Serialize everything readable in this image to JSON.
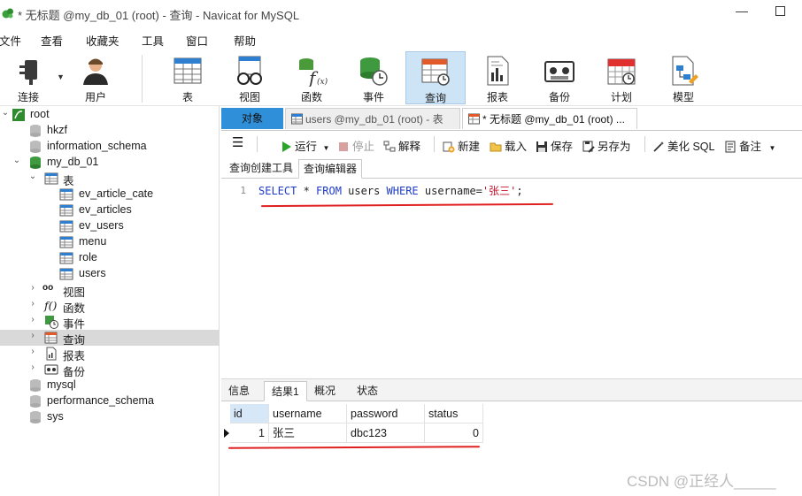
{
  "window": {
    "title": "* 无标题 @my_db_01 (root) - 查询 - Navicat for MySQL",
    "minimize_glyph": "—"
  },
  "menu": [
    "文件",
    "查看",
    "收藏夹",
    "工具",
    "窗口",
    "帮助"
  ],
  "toolbar": {
    "connect": "连接",
    "user": "用户",
    "table": "表",
    "view": "视图",
    "function": "函数",
    "event": "事件",
    "query": "查询",
    "report": "报表",
    "backup": "备份",
    "schedule": "计划",
    "model": "模型"
  },
  "tree": {
    "root": "root",
    "hkzf": "hkzf",
    "information_schema": "information_schema",
    "my_db_01": "my_db_01",
    "tables_group": "表",
    "tables": [
      "ev_article_cate",
      "ev_articles",
      "ev_users",
      "menu",
      "role",
      "users"
    ],
    "views_group": "视图",
    "functions_group": "函数",
    "events_group": "事件",
    "queries_group": "查询",
    "reports_group": "报表",
    "backups_group": "备份",
    "mysql": "mysql",
    "performance_schema": "performance_schema",
    "sys": "sys"
  },
  "tabs": {
    "objects": "对象",
    "users_tab": "users @my_db_01 (root) - 表",
    "query_tab": "* 无标题 @my_db_01 (root) ..."
  },
  "query_toolbar": {
    "run": "运行",
    "stop": "停止",
    "explain": "解释",
    "new": "新建",
    "load": "载入",
    "save": "保存",
    "save_as": "另存为",
    "beautify": "美化 SQL",
    "notes": "备注"
  },
  "editor_tabs": {
    "builder": "查询创建工具",
    "editor": "查询编辑器"
  },
  "sql": {
    "line_number": "1",
    "select": "SELECT",
    "star": " * ",
    "from": "FROM",
    "table": " users ",
    "where": "WHERE",
    "condition": " username=",
    "value": "'张三'",
    "end": ";"
  },
  "result_tabs": [
    "信息",
    "结果1",
    "概况",
    "状态"
  ],
  "result": {
    "columns": [
      "id",
      "username",
      "password",
      "status"
    ],
    "rows": [
      [
        "1",
        "张三",
        "dbc123",
        "0"
      ]
    ]
  },
  "watermark": "CSDN @正经人_____"
}
